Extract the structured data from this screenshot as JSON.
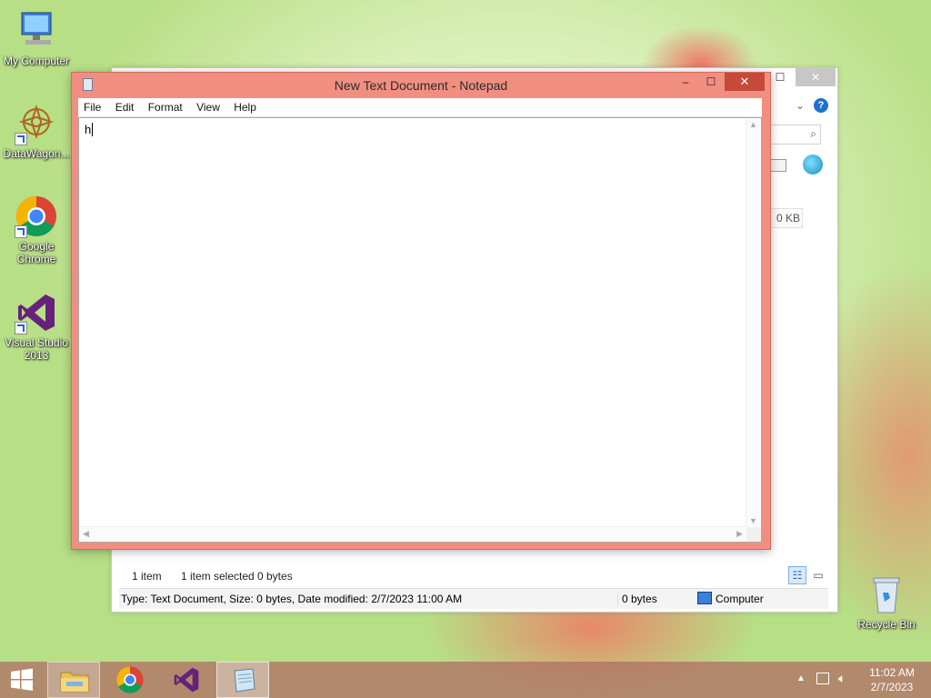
{
  "desktop": {
    "icons": [
      {
        "label": "My Computer"
      },
      {
        "label": "DataWagon..."
      },
      {
        "label": "Google Chrome"
      },
      {
        "label": "Visual Studio 2013"
      },
      {
        "label": "Recycle Bin"
      }
    ]
  },
  "explorer": {
    "size_cell": "0 KB",
    "status": {
      "items": "1 item",
      "selected": "1 item selected",
      "bytes": "0 bytes"
    },
    "details": {
      "info": "Type: Text Document, Size: 0 bytes, Date modified: 2/7/2023 11:00 AM",
      "size": "0 bytes",
      "location": "Computer"
    }
  },
  "notepad": {
    "title": "New Text Document - Notepad",
    "menu": [
      "File",
      "Edit",
      "Format",
      "View",
      "Help"
    ],
    "content": "h"
  },
  "taskbar": {
    "time": "11:02 AM",
    "date": "2/7/2023"
  }
}
